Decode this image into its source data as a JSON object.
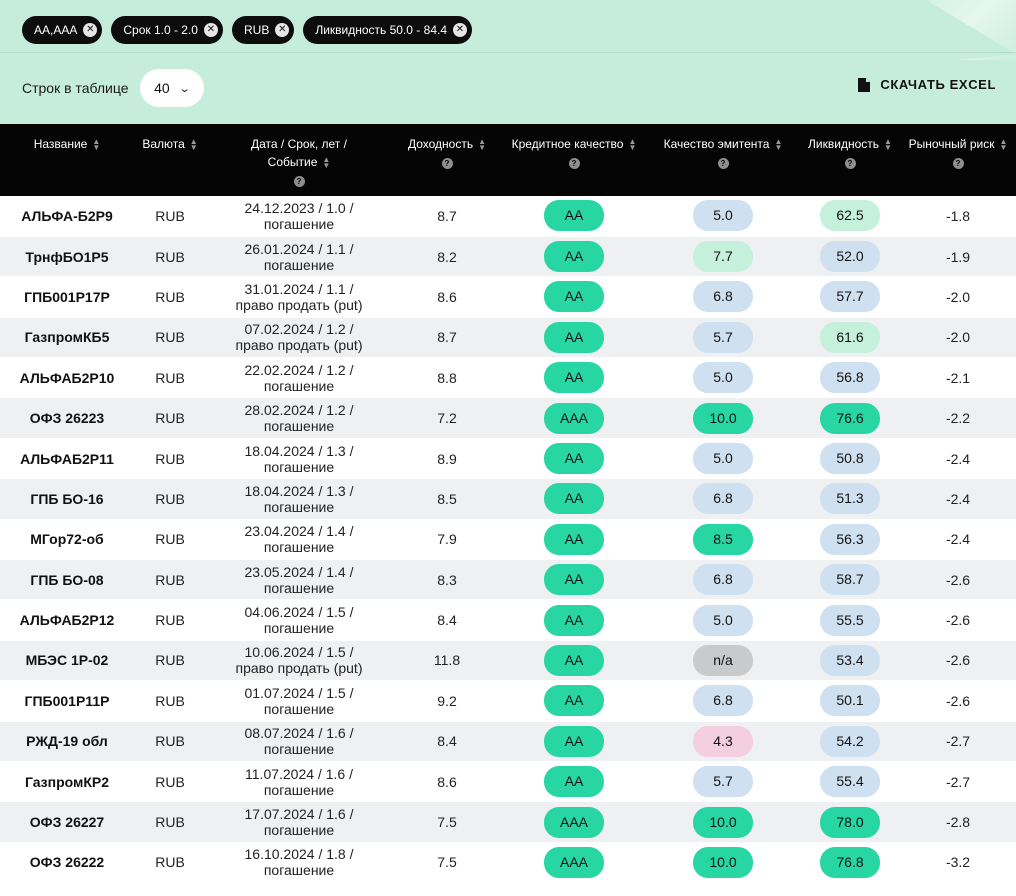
{
  "filters": [
    {
      "label": "АА,ААА"
    },
    {
      "label": "Срок 1.0 - 2.0"
    },
    {
      "label": "RUB"
    },
    {
      "label": "Ликвидность 50.0 - 84.4"
    }
  ],
  "chip_close_glyph": "✕",
  "controls": {
    "rows_label": "Строк в таблице",
    "rows_value": "40",
    "download_label": "СКАЧАТЬ EXCEL"
  },
  "icons": {
    "sort": "sort-icon",
    "help": "question-icon",
    "file": "file-icon",
    "chevron": "chevron-down-icon"
  },
  "colors": {
    "header_bg": "#050505",
    "top_bg": "#c6ecdb",
    "pill_green": "#28d6a4",
    "pill_blue": "#cfe0f1",
    "pill_mint": "#c5f0dc",
    "pill_pink": "#f4cfdf",
    "pill_gray": "#c8cacc"
  },
  "table": {
    "columns": [
      {
        "label": "Название",
        "help": false
      },
      {
        "label": "Валюта",
        "help": false
      },
      {
        "label": "Дата / Срок, лет / Событие",
        "help": true
      },
      {
        "label": "Доходность",
        "help": true
      },
      {
        "label": "Кредитное качество",
        "help": true
      },
      {
        "label": "Качество эмитента",
        "help": true
      },
      {
        "label": "Ликвидность",
        "help": true
      },
      {
        "label": "Рыночный риск",
        "help": true
      }
    ],
    "rows": [
      {
        "name": "АЛЬФА-Б2Р9",
        "currency": "RUB",
        "date1": "24.12.2023 / 1.0 /",
        "date2": "погашение",
        "yield": "8.7",
        "credit": "AA",
        "credit_color": "green",
        "issuer": "5.0",
        "issuer_color": "blue",
        "liquidity": "62.5",
        "liquidity_color": "mint",
        "risk": "-1.8"
      },
      {
        "name": "ТрнфБО1Р5",
        "currency": "RUB",
        "date1": "26.01.2024 / 1.1 /",
        "date2": "погашение",
        "yield": "8.2",
        "credit": "AA",
        "credit_color": "green",
        "issuer": "7.7",
        "issuer_color": "mint",
        "liquidity": "52.0",
        "liquidity_color": "blue",
        "risk": "-1.9"
      },
      {
        "name": "ГПБ001Р17Р",
        "currency": "RUB",
        "date1": "31.01.2024 / 1.1 /",
        "date2": "право продать (put)",
        "yield": "8.6",
        "credit": "AA",
        "credit_color": "green",
        "issuer": "6.8",
        "issuer_color": "blue",
        "liquidity": "57.7",
        "liquidity_color": "blue",
        "risk": "-2.0"
      },
      {
        "name": "ГазпромКБ5",
        "currency": "RUB",
        "date1": "07.02.2024 / 1.2 /",
        "date2": "право продать (put)",
        "yield": "8.7",
        "credit": "AA",
        "credit_color": "green",
        "issuer": "5.7",
        "issuer_color": "blue",
        "liquidity": "61.6",
        "liquidity_color": "mint",
        "risk": "-2.0"
      },
      {
        "name": "АЛЬФАБ2Р10",
        "currency": "RUB",
        "date1": "22.02.2024 / 1.2 /",
        "date2": "погашение",
        "yield": "8.8",
        "credit": "AA",
        "credit_color": "green",
        "issuer": "5.0",
        "issuer_color": "blue",
        "liquidity": "56.8",
        "liquidity_color": "blue",
        "risk": "-2.1"
      },
      {
        "name": "ОФЗ 26223",
        "currency": "RUB",
        "date1": "28.02.2024 / 1.2 /",
        "date2": "погашение",
        "yield": "7.2",
        "credit": "AAA",
        "credit_color": "green",
        "issuer": "10.0",
        "issuer_color": "green",
        "liquidity": "76.6",
        "liquidity_color": "green",
        "risk": "-2.2"
      },
      {
        "name": "АЛЬФАБ2Р11",
        "currency": "RUB",
        "date1": "18.04.2024 / 1.3 /",
        "date2": "погашение",
        "yield": "8.9",
        "credit": "AA",
        "credit_color": "green",
        "issuer": "5.0",
        "issuer_color": "blue",
        "liquidity": "50.8",
        "liquidity_color": "blue",
        "risk": "-2.4"
      },
      {
        "name": "ГПБ БО-16",
        "currency": "RUB",
        "date1": "18.04.2024 / 1.3 /",
        "date2": "погашение",
        "yield": "8.5",
        "credit": "AA",
        "credit_color": "green",
        "issuer": "6.8",
        "issuer_color": "blue",
        "liquidity": "51.3",
        "liquidity_color": "blue",
        "risk": "-2.4"
      },
      {
        "name": "МГор72-об",
        "currency": "RUB",
        "date1": "23.04.2024 / 1.4 /",
        "date2": "погашение",
        "yield": "7.9",
        "credit": "AA",
        "credit_color": "green",
        "issuer": "8.5",
        "issuer_color": "green",
        "liquidity": "56.3",
        "liquidity_color": "blue",
        "risk": "-2.4"
      },
      {
        "name": "ГПБ БО-08",
        "currency": "RUB",
        "date1": "23.05.2024 / 1.4 /",
        "date2": "погашение",
        "yield": "8.3",
        "credit": "AA",
        "credit_color": "green",
        "issuer": "6.8",
        "issuer_color": "blue",
        "liquidity": "58.7",
        "liquidity_color": "blue",
        "risk": "-2.6"
      },
      {
        "name": "АЛЬФАБ2Р12",
        "currency": "RUB",
        "date1": "04.06.2024 / 1.5 /",
        "date2": "погашение",
        "yield": "8.4",
        "credit": "AA",
        "credit_color": "green",
        "issuer": "5.0",
        "issuer_color": "blue",
        "liquidity": "55.5",
        "liquidity_color": "blue",
        "risk": "-2.6"
      },
      {
        "name": "МБЭС 1Р-02",
        "currency": "RUB",
        "date1": "10.06.2024 / 1.5 /",
        "date2": "право продать (put)",
        "yield": "11.8",
        "credit": "AA",
        "credit_color": "green",
        "issuer": "n/a",
        "issuer_color": "gray",
        "liquidity": "53.4",
        "liquidity_color": "blue",
        "risk": "-2.6"
      },
      {
        "name": "ГПБ001Р11Р",
        "currency": "RUB",
        "date1": "01.07.2024 / 1.5 /",
        "date2": "погашение",
        "yield": "9.2",
        "credit": "AA",
        "credit_color": "green",
        "issuer": "6.8",
        "issuer_color": "blue",
        "liquidity": "50.1",
        "liquidity_color": "blue",
        "risk": "-2.6"
      },
      {
        "name": "РЖД-19 обл",
        "currency": "RUB",
        "date1": "08.07.2024 / 1.6 /",
        "date2": "погашение",
        "yield": "8.4",
        "credit": "AA",
        "credit_color": "green",
        "issuer": "4.3",
        "issuer_color": "pink",
        "liquidity": "54.2",
        "liquidity_color": "blue",
        "risk": "-2.7"
      },
      {
        "name": "ГазпромКР2",
        "currency": "RUB",
        "date1": "11.07.2024 / 1.6 /",
        "date2": "погашение",
        "yield": "8.6",
        "credit": "AA",
        "credit_color": "green",
        "issuer": "5.7",
        "issuer_color": "blue",
        "liquidity": "55.4",
        "liquidity_color": "blue",
        "risk": "-2.7"
      },
      {
        "name": "ОФЗ 26227",
        "currency": "RUB",
        "date1": "17.07.2024 / 1.6 /",
        "date2": "погашение",
        "yield": "7.5",
        "credit": "AAA",
        "credit_color": "green",
        "issuer": "10.0",
        "issuer_color": "green",
        "liquidity": "78.0",
        "liquidity_color": "green",
        "risk": "-2.8"
      },
      {
        "name": "ОФЗ 26222",
        "currency": "RUB",
        "date1": "16.10.2024 / 1.8 /",
        "date2": "погашение",
        "yield": "7.5",
        "credit": "AAA",
        "credit_color": "green",
        "issuer": "10.0",
        "issuer_color": "green",
        "liquidity": "76.8",
        "liquidity_color": "green",
        "risk": "-3.2"
      }
    ]
  }
}
